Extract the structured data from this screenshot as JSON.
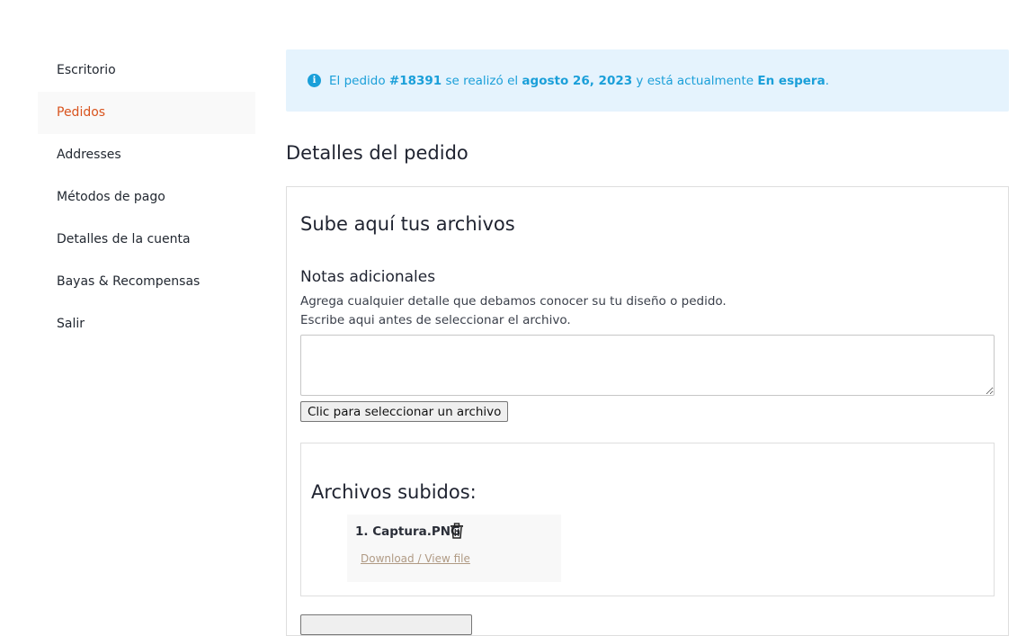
{
  "sidebar": {
    "items": [
      {
        "label": "Escritorio"
      },
      {
        "label": "Pedidos",
        "active": true
      },
      {
        "label": "Addresses"
      },
      {
        "label": "Métodos de pago"
      },
      {
        "label": "Detalles de la cuenta"
      },
      {
        "label": "Bayas & Recompensas"
      },
      {
        "label": "Salir"
      }
    ]
  },
  "notice": {
    "icon": "info-icon",
    "prefix": "El pedido ",
    "order_number": "#18391",
    "middle": " se realizó el ",
    "date": "agosto 26, 2023",
    "suffix": " y está actualmente ",
    "status": "En espera",
    "end": "."
  },
  "order_details": {
    "title": "Detalles del pedido"
  },
  "upload": {
    "title": "Sube aquí tus archivos",
    "notes_title": "Notas adicionales",
    "help_line1": "Agrega cualquier detalle que debamos conocer su tu diseño o pedido.",
    "help_line2": "Escribe aqui antes de seleccionar el archivo.",
    "notes_value": "",
    "select_button": "Clic para seleccionar un archivo"
  },
  "uploaded": {
    "title": "Archivos subidos:",
    "files": [
      {
        "name": "1. Captura.PNG",
        "link": "Download / View file",
        "icon": "trash-icon"
      }
    ]
  },
  "colors": {
    "accent": "#d9541e",
    "info": "#1a9fd9",
    "info_bg": "#e5f3fd"
  }
}
